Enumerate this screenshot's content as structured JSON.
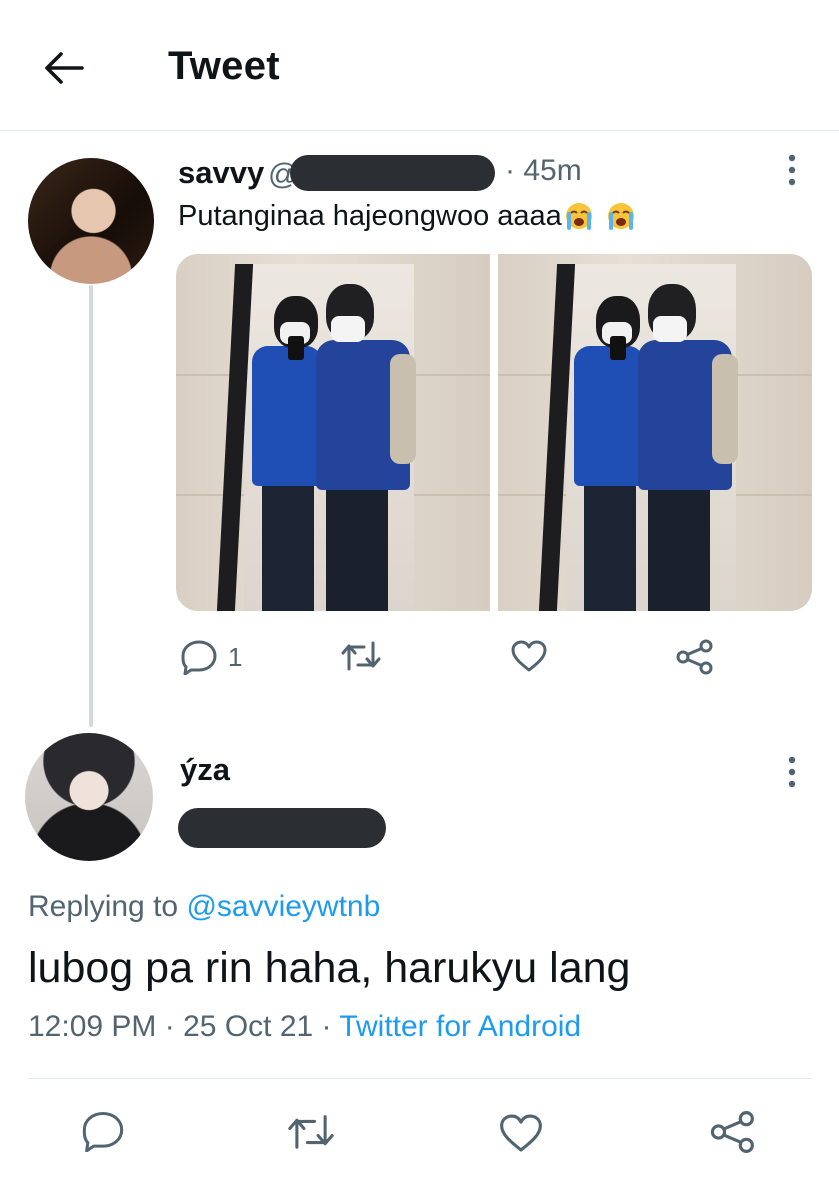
{
  "header": {
    "title": "Tweet",
    "back_icon": "arrow-left-icon"
  },
  "tweet": {
    "author_name": "savvy",
    "handle_prefix": "@",
    "time_separator": "·",
    "time": "45m",
    "text": "Putanginaa hajeongwoo aaaa",
    "emojis": [
      "loudly-crying-face",
      "loudly-crying-face"
    ],
    "reply_count": "1",
    "images": [
      "mirror-selfie-photo",
      "mirror-selfie-photo"
    ]
  },
  "reply": {
    "author_name": "ýza",
    "replying_to_label": "Replying to",
    "replying_to_handle": "@savvieywtnb",
    "text": "lubog pa rin haha, harukyu lang",
    "time": "12:09 PM",
    "sep1": "·",
    "date": "25 Oct 21",
    "sep2": "·",
    "source": "Twitter for Android"
  },
  "colors": {
    "link": "#1d9bf0",
    "secondary_text": "#536471",
    "divider": "#e6ecf0",
    "redaction": "#2b2e33"
  }
}
